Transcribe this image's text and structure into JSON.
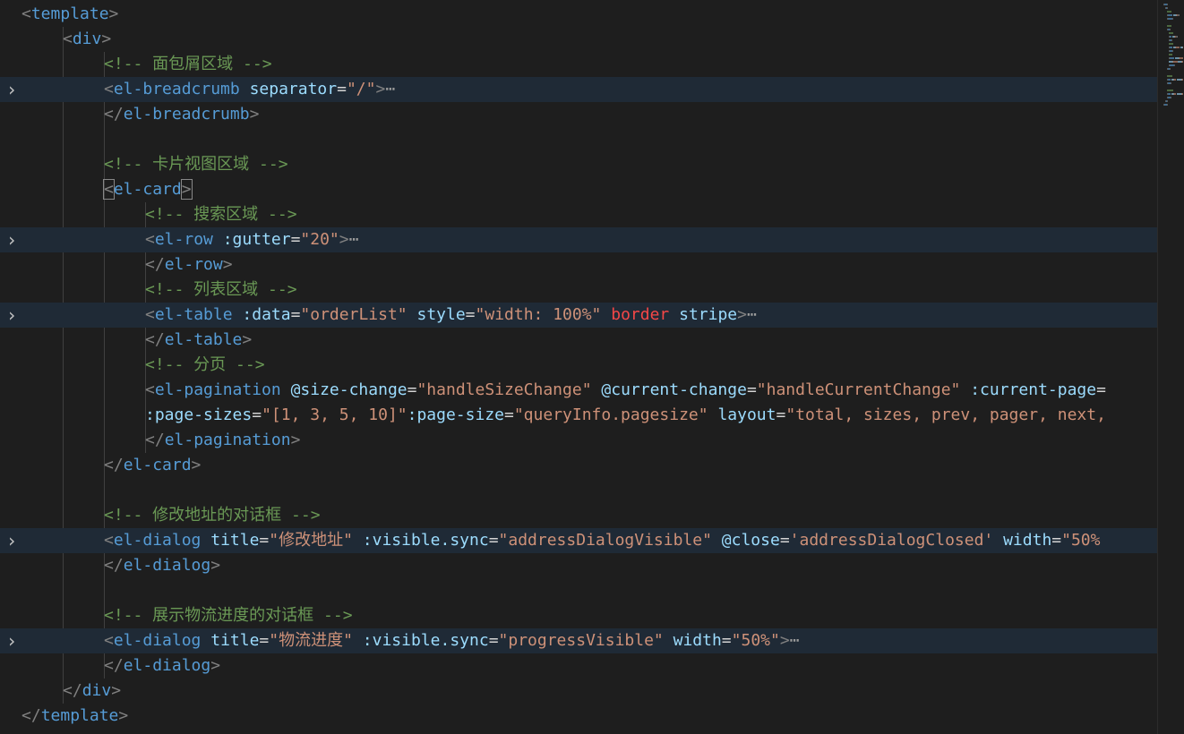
{
  "editor": {
    "language": "vue",
    "lines": [
      {
        "fold": false,
        "indent": 0,
        "tokens": [
          {
            "k": "p",
            "v": "<"
          },
          {
            "k": "t",
            "v": "template"
          },
          {
            "k": "p",
            "v": ">"
          }
        ]
      },
      {
        "fold": false,
        "indent": 1,
        "tokens": [
          {
            "k": "p",
            "v": "<"
          },
          {
            "k": "t",
            "v": "div"
          },
          {
            "k": "p",
            "v": ">"
          }
        ]
      },
      {
        "fold": false,
        "indent": 2,
        "tokens": [
          {
            "k": "c",
            "v": "<!-- 面包屑区域 -->"
          }
        ]
      },
      {
        "fold": true,
        "indent": 2,
        "tokens": [
          {
            "k": "p",
            "v": "<"
          },
          {
            "k": "t",
            "v": "el-breadcrumb"
          },
          {
            "k": "w",
            "v": " "
          },
          {
            "k": "a",
            "v": "separator"
          },
          {
            "k": "w",
            "v": "="
          },
          {
            "k": "s",
            "v": "\"/\""
          },
          {
            "k": "p",
            "v": ">"
          },
          {
            "k": "e",
            "v": "⋯"
          }
        ]
      },
      {
        "fold": false,
        "indent": 2,
        "tokens": [
          {
            "k": "p",
            "v": "</"
          },
          {
            "k": "t",
            "v": "el-breadcrumb"
          },
          {
            "k": "p",
            "v": ">"
          }
        ]
      },
      {
        "fold": false,
        "indent": 2,
        "tokens": []
      },
      {
        "fold": false,
        "indent": 2,
        "tokens": [
          {
            "k": "c",
            "v": "<!-- 卡片视图区域 -->"
          }
        ]
      },
      {
        "fold": false,
        "indent": 2,
        "tokens": [
          {
            "k": "p br",
            "v": "<"
          },
          {
            "k": "t",
            "v": "el-card"
          },
          {
            "k": "p br",
            "v": ">"
          }
        ]
      },
      {
        "fold": false,
        "indent": 3,
        "tokens": [
          {
            "k": "c",
            "v": "<!-- 搜索区域 -->"
          }
        ]
      },
      {
        "fold": true,
        "indent": 3,
        "tokens": [
          {
            "k": "p",
            "v": "<"
          },
          {
            "k": "t",
            "v": "el-row"
          },
          {
            "k": "w",
            "v": " "
          },
          {
            "k": "a",
            "v": ":gutter"
          },
          {
            "k": "w",
            "v": "="
          },
          {
            "k": "s",
            "v": "\"20\""
          },
          {
            "k": "p",
            "v": ">"
          },
          {
            "k": "e",
            "v": "⋯"
          }
        ]
      },
      {
        "fold": false,
        "indent": 3,
        "tokens": [
          {
            "k": "p",
            "v": "</"
          },
          {
            "k": "t",
            "v": "el-row"
          },
          {
            "k": "p",
            "v": ">"
          }
        ]
      },
      {
        "fold": false,
        "indent": 3,
        "tokens": [
          {
            "k": "c",
            "v": "<!-- 列表区域 -->"
          }
        ]
      },
      {
        "fold": true,
        "indent": 3,
        "tokens": [
          {
            "k": "p",
            "v": "<"
          },
          {
            "k": "t",
            "v": "el-table"
          },
          {
            "k": "w",
            "v": " "
          },
          {
            "k": "a",
            "v": ":data"
          },
          {
            "k": "w",
            "v": "="
          },
          {
            "k": "s",
            "v": "\"orderList\""
          },
          {
            "k": "w",
            "v": " "
          },
          {
            "k": "a",
            "v": "style"
          },
          {
            "k": "w",
            "v": "="
          },
          {
            "k": "s",
            "v": "\"width: 100%\""
          },
          {
            "k": "w",
            "v": " "
          },
          {
            "k": "r",
            "v": "border"
          },
          {
            "k": "w",
            "v": " "
          },
          {
            "k": "a",
            "v": "stripe"
          },
          {
            "k": "p",
            "v": ">"
          },
          {
            "k": "e",
            "v": "⋯"
          }
        ]
      },
      {
        "fold": false,
        "indent": 3,
        "tokens": [
          {
            "k": "p",
            "v": "</"
          },
          {
            "k": "t",
            "v": "el-table"
          },
          {
            "k": "p",
            "v": ">"
          }
        ]
      },
      {
        "fold": false,
        "indent": 3,
        "tokens": [
          {
            "k": "c",
            "v": "<!-- 分页 -->"
          }
        ]
      },
      {
        "fold": false,
        "indent": 3,
        "tokens": [
          {
            "k": "p",
            "v": "<"
          },
          {
            "k": "t",
            "v": "el-pagination"
          },
          {
            "k": "w",
            "v": " "
          },
          {
            "k": "a",
            "v": "@size-change"
          },
          {
            "k": "w",
            "v": "="
          },
          {
            "k": "s",
            "v": "\"handleSizeChange\""
          },
          {
            "k": "w",
            "v": " "
          },
          {
            "k": "a",
            "v": "@current-change"
          },
          {
            "k": "w",
            "v": "="
          },
          {
            "k": "s",
            "v": "\"handleCurrentChange\""
          },
          {
            "k": "w",
            "v": " "
          },
          {
            "k": "a",
            "v": ":current-page"
          },
          {
            "k": "w",
            "v": "="
          }
        ]
      },
      {
        "fold": false,
        "indent": 3,
        "tokens": [
          {
            "k": "a",
            "v": ":page-sizes"
          },
          {
            "k": "w",
            "v": "="
          },
          {
            "k": "s",
            "v": "\"[1, 3, 5, 10]\""
          },
          {
            "k": "a",
            "v": ":page-size"
          },
          {
            "k": "w",
            "v": "="
          },
          {
            "k": "s",
            "v": "\"queryInfo.pagesize\""
          },
          {
            "k": "w",
            "v": " "
          },
          {
            "k": "a",
            "v": "layout"
          },
          {
            "k": "w",
            "v": "="
          },
          {
            "k": "s",
            "v": "\"total, sizes, prev, pager, next,"
          }
        ]
      },
      {
        "fold": false,
        "indent": 3,
        "tokens": [
          {
            "k": "p",
            "v": "</"
          },
          {
            "k": "t",
            "v": "el-pagination"
          },
          {
            "k": "p",
            "v": ">"
          }
        ]
      },
      {
        "fold": false,
        "indent": 2,
        "tokens": [
          {
            "k": "p",
            "v": "</"
          },
          {
            "k": "t",
            "v": "el-card"
          },
          {
            "k": "p",
            "v": ">"
          }
        ]
      },
      {
        "fold": false,
        "indent": 2,
        "tokens": []
      },
      {
        "fold": false,
        "indent": 2,
        "tokens": [
          {
            "k": "c",
            "v": "<!-- 修改地址的对话框 -->"
          }
        ]
      },
      {
        "fold": true,
        "indent": 2,
        "tokens": [
          {
            "k": "p",
            "v": "<"
          },
          {
            "k": "t",
            "v": "el-dialog"
          },
          {
            "k": "w",
            "v": " "
          },
          {
            "k": "a",
            "v": "title"
          },
          {
            "k": "w",
            "v": "="
          },
          {
            "k": "s",
            "v": "\"修改地址\""
          },
          {
            "k": "w",
            "v": " "
          },
          {
            "k": "a",
            "v": ":visible.sync"
          },
          {
            "k": "w",
            "v": "="
          },
          {
            "k": "s",
            "v": "\"addressDialogVisible\""
          },
          {
            "k": "w",
            "v": " "
          },
          {
            "k": "a",
            "v": "@close"
          },
          {
            "k": "w",
            "v": "="
          },
          {
            "k": "s",
            "v": "'addressDialogClosed'"
          },
          {
            "k": "w",
            "v": " "
          },
          {
            "k": "a",
            "v": "width"
          },
          {
            "k": "w",
            "v": "="
          },
          {
            "k": "s",
            "v": "\"50%"
          }
        ]
      },
      {
        "fold": false,
        "indent": 2,
        "tokens": [
          {
            "k": "p",
            "v": "</"
          },
          {
            "k": "t",
            "v": "el-dialog"
          },
          {
            "k": "p",
            "v": ">"
          }
        ]
      },
      {
        "fold": false,
        "indent": 2,
        "tokens": []
      },
      {
        "fold": false,
        "indent": 2,
        "tokens": [
          {
            "k": "c",
            "v": "<!-- 展示物流进度的对话框 -->"
          }
        ]
      },
      {
        "fold": true,
        "indent": 2,
        "tokens": [
          {
            "k": "p",
            "v": "<"
          },
          {
            "k": "t",
            "v": "el-dialog"
          },
          {
            "k": "w",
            "v": " "
          },
          {
            "k": "a",
            "v": "title"
          },
          {
            "k": "w",
            "v": "="
          },
          {
            "k": "s",
            "v": "\"物流进度\""
          },
          {
            "k": "w",
            "v": " "
          },
          {
            "k": "a",
            "v": ":visible.sync"
          },
          {
            "k": "w",
            "v": "="
          },
          {
            "k": "s",
            "v": "\"progressVisible\""
          },
          {
            "k": "w",
            "v": " "
          },
          {
            "k": "a",
            "v": "width"
          },
          {
            "k": "w",
            "v": "="
          },
          {
            "k": "s",
            "v": "\"50%\""
          },
          {
            "k": "p",
            "v": ">"
          },
          {
            "k": "e",
            "v": "⋯"
          }
        ]
      },
      {
        "fold": false,
        "indent": 2,
        "tokens": [
          {
            "k": "p",
            "v": "</"
          },
          {
            "k": "t",
            "v": "el-dialog"
          },
          {
            "k": "p",
            "v": ">"
          }
        ]
      },
      {
        "fold": false,
        "indent": 1,
        "tokens": [
          {
            "k": "p",
            "v": "</"
          },
          {
            "k": "t",
            "v": "div"
          },
          {
            "k": "p",
            "v": ">"
          }
        ]
      },
      {
        "fold": false,
        "indent": 0,
        "tokens": [
          {
            "k": "p",
            "v": "</"
          },
          {
            "k": "t",
            "v": "template"
          },
          {
            "k": "p",
            "v": ">"
          }
        ]
      }
    ],
    "fold_icon": "chevron-right-icon"
  }
}
